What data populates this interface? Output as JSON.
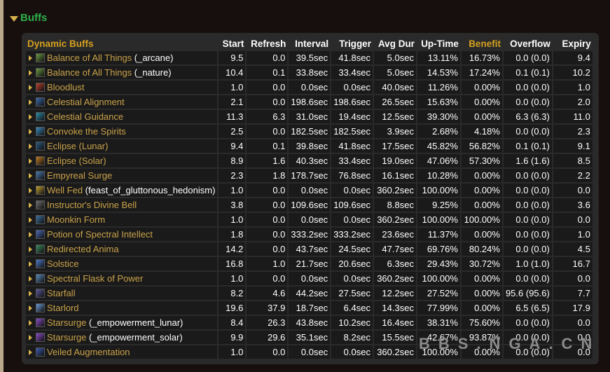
{
  "section": {
    "title": "Buffs"
  },
  "table": {
    "headers": {
      "name": "Dynamic Buffs",
      "start": "Start",
      "refresh": "Refresh",
      "interval": "Interval",
      "trigger": "Trigger",
      "avgdur": "Avg Dur",
      "uptime": "Up-Time",
      "benefit": "Benefit",
      "overflow": "Overflow",
      "expiry": "Expiry"
    },
    "rows": [
      {
        "name": "Balance of All Things",
        "suffix": " (_arcane)",
        "icon": "balance-of-all-things-icon",
        "color": "#6a9a40",
        "start": "9.5",
        "refresh": "0.0",
        "interval": "39.5sec",
        "trigger": "41.8sec",
        "avgdur": "5.0sec",
        "uptime": "13.11%",
        "benefit": "16.73%",
        "overflow": "0.0 (0.0)",
        "expiry": "9.4"
      },
      {
        "name": "Balance of All Things",
        "suffix": " (_nature)",
        "icon": "balance-of-all-things-icon",
        "color": "#6a9a40",
        "start": "10.4",
        "refresh": "0.1",
        "interval": "33.8sec",
        "trigger": "33.4sec",
        "avgdur": "5.0sec",
        "uptime": "14.53%",
        "benefit": "17.24%",
        "overflow": "0.1 (0.1)",
        "expiry": "10.2"
      },
      {
        "name": "Bloodlust",
        "suffix": "",
        "icon": "bloodlust-icon",
        "color": "#b8402a",
        "start": "1.0",
        "refresh": "0.0",
        "interval": "0.0sec",
        "trigger": "0.0sec",
        "avgdur": "40.0sec",
        "uptime": "11.26%",
        "benefit": "0.00%",
        "overflow": "0.0 (0.0)",
        "expiry": "1.0"
      },
      {
        "name": "Celestial Alignment",
        "suffix": "",
        "icon": "celestial-alignment-icon",
        "color": "#3a6ab0",
        "start": "2.1",
        "refresh": "0.0",
        "interval": "198.6sec",
        "trigger": "198.6sec",
        "avgdur": "26.5sec",
        "uptime": "15.63%",
        "benefit": "0.00%",
        "overflow": "0.0 (0.0)",
        "expiry": "2.0"
      },
      {
        "name": "Celestial Guidance",
        "suffix": "",
        "icon": "celestial-guidance-icon",
        "color": "#2a8aa8",
        "start": "11.3",
        "refresh": "6.3",
        "interval": "31.0sec",
        "trigger": "19.4sec",
        "avgdur": "12.5sec",
        "uptime": "39.30%",
        "benefit": "0.00%",
        "overflow": "6.3 (6.3)",
        "expiry": "11.0"
      },
      {
        "name": "Convoke the Spirits",
        "suffix": "",
        "icon": "convoke-the-spirits-icon",
        "color": "#3a8ac0",
        "start": "2.5",
        "refresh": "0.0",
        "interval": "182.5sec",
        "trigger": "182.5sec",
        "avgdur": "3.9sec",
        "uptime": "2.68%",
        "benefit": "4.18%",
        "overflow": "0.0 (0.0)",
        "expiry": "2.3"
      },
      {
        "name": "Eclipse (Lunar)",
        "suffix": "",
        "icon": "eclipse-lunar-icon",
        "color": "#2a5a80",
        "start": "9.4",
        "refresh": "0.1",
        "interval": "39.8sec",
        "trigger": "41.8sec",
        "avgdur": "17.5sec",
        "uptime": "45.82%",
        "benefit": "56.82%",
        "overflow": "0.1 (0.1)",
        "expiry": "9.1"
      },
      {
        "name": "Eclipse (Solar)",
        "suffix": "",
        "icon": "eclipse-solar-icon",
        "color": "#c07a20",
        "start": "8.9",
        "refresh": "1.6",
        "interval": "40.3sec",
        "trigger": "33.4sec",
        "avgdur": "19.0sec",
        "uptime": "47.06%",
        "benefit": "57.30%",
        "overflow": "1.6 (1.6)",
        "expiry": "8.5"
      },
      {
        "name": "Empyreal Surge",
        "suffix": "",
        "icon": "empyreal-surge-icon",
        "color": "#4a7ab0",
        "start": "2.3",
        "refresh": "1.8",
        "interval": "178.7sec",
        "trigger": "76.8sec",
        "avgdur": "16.1sec",
        "uptime": "10.28%",
        "benefit": "0.00%",
        "overflow": "0.0 (0.0)",
        "expiry": "2.2"
      },
      {
        "name": "Well Fed",
        "suffix": " (feast_of_gluttonous_hedonism)",
        "icon": "well-fed-icon",
        "color": "#c0a030",
        "start": "1.0",
        "refresh": "0.0",
        "interval": "0.0sec",
        "trigger": "0.0sec",
        "avgdur": "360.2sec",
        "uptime": "100.00%",
        "benefit": "0.00%",
        "overflow": "0.0 (0.0)",
        "expiry": "0.0"
      },
      {
        "name": "Instructor's Divine Bell",
        "suffix": "",
        "icon": "divine-bell-icon",
        "color": "#707070",
        "start": "3.8",
        "refresh": "0.0",
        "interval": "109.6sec",
        "trigger": "109.6sec",
        "avgdur": "8.8sec",
        "uptime": "9.25%",
        "benefit": "0.00%",
        "overflow": "0.0 (0.0)",
        "expiry": "3.6"
      },
      {
        "name": "Moonkin Form",
        "suffix": "",
        "icon": "moonkin-form-icon",
        "color": "#3a70a0",
        "start": "1.0",
        "refresh": "0.0",
        "interval": "0.0sec",
        "trigger": "0.0sec",
        "avgdur": "360.2sec",
        "uptime": "100.00%",
        "benefit": "100.00%",
        "overflow": "0.0 (0.0)",
        "expiry": "0.0"
      },
      {
        "name": "Potion of Spectral Intellect",
        "suffix": "",
        "icon": "potion-icon",
        "color": "#4a6ab8",
        "start": "1.8",
        "refresh": "0.0",
        "interval": "333.2sec",
        "trigger": "333.2sec",
        "avgdur": "23.6sec",
        "uptime": "11.37%",
        "benefit": "0.00%",
        "overflow": "0.0 (0.0)",
        "expiry": "1.0"
      },
      {
        "name": "Redirected Anima",
        "suffix": "",
        "icon": "redirected-anima-icon",
        "color": "#3a8a60",
        "start": "14.2",
        "refresh": "0.0",
        "interval": "43.7sec",
        "trigger": "24.5sec",
        "avgdur": "47.7sec",
        "uptime": "69.76%",
        "benefit": "80.24%",
        "overflow": "0.0 (0.0)",
        "expiry": "4.5"
      },
      {
        "name": "Solstice",
        "suffix": "",
        "icon": "solstice-icon",
        "color": "#4a7ac8",
        "start": "16.8",
        "refresh": "1.0",
        "interval": "21.7sec",
        "trigger": "20.6sec",
        "avgdur": "6.3sec",
        "uptime": "29.43%",
        "benefit": "30.72%",
        "overflow": "1.0 (1.0)",
        "expiry": "16.7"
      },
      {
        "name": "Spectral Flask of Power",
        "suffix": "",
        "icon": "flask-icon",
        "color": "#5a8ac0",
        "start": "1.0",
        "refresh": "0.0",
        "interval": "0.0sec",
        "trigger": "0.0sec",
        "avgdur": "360.2sec",
        "uptime": "100.00%",
        "benefit": "0.00%",
        "overflow": "0.0 (0.0)",
        "expiry": "0.0"
      },
      {
        "name": "Starfall",
        "suffix": "",
        "icon": "starfall-icon",
        "color": "#5a5a9a",
        "start": "8.2",
        "refresh": "4.6",
        "interval": "44.2sec",
        "trigger": "27.5sec",
        "avgdur": "12.2sec",
        "uptime": "27.52%",
        "benefit": "0.00%",
        "overflow": "95.6 (95.6)",
        "expiry": "7.7"
      },
      {
        "name": "Starlord",
        "suffix": "",
        "icon": "starlord-icon",
        "color": "#6a9ad8",
        "start": "19.6",
        "refresh": "37.9",
        "interval": "18.7sec",
        "trigger": "6.4sec",
        "avgdur": "14.3sec",
        "uptime": "77.99%",
        "benefit": "0.00%",
        "overflow": "6.5 (6.5)",
        "expiry": "17.9"
      },
      {
        "name": "Starsurge",
        "suffix": " (_empowerment_lunar)",
        "icon": "starsurge-icon",
        "color": "#8a4ac8",
        "start": "8.4",
        "refresh": "26.3",
        "interval": "43.8sec",
        "trigger": "10.2sec",
        "avgdur": "16.4sec",
        "uptime": "38.31%",
        "benefit": "75.60%",
        "overflow": "0.0 (0.0)",
        "expiry": "0.0"
      },
      {
        "name": "Starsurge",
        "suffix": " (_empowerment_solar)",
        "icon": "starsurge-icon",
        "color": "#8a4ac8",
        "start": "9.9",
        "refresh": "29.6",
        "interval": "35.1sec",
        "trigger": "8.2sec",
        "avgdur": "15.5sec",
        "uptime": "42.67%",
        "benefit": "93.87%",
        "overflow": "0.0 (0.0)",
        "expiry": "0.0"
      },
      {
        "name": "Veiled Augmentation",
        "suffix": "",
        "icon": "veiled-augmentation-icon",
        "color": "#3a5ab0",
        "start": "1.0",
        "refresh": "0.0",
        "interval": "0.0sec",
        "trigger": "0.0sec",
        "avgdur": "360.2sec",
        "uptime": "100.00%",
        "benefit": "0.00%",
        "overflow": "0.0 (0.0)",
        "expiry": "0.0"
      }
    ]
  },
  "watermark": "BBS.NGA.CN"
}
